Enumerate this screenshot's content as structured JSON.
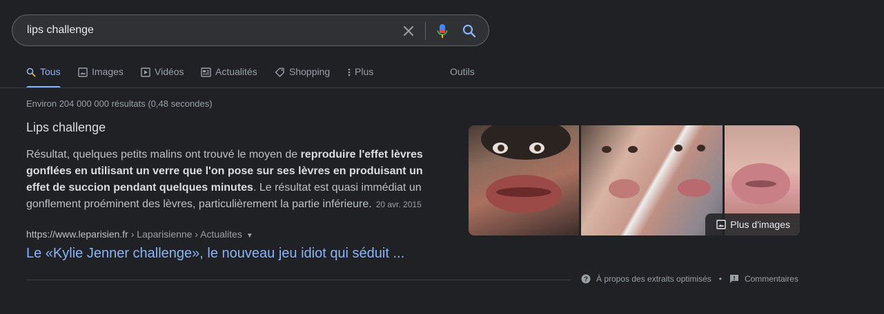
{
  "search": {
    "query": "lips challenge",
    "clear_icon": "close-icon",
    "mic_icon": "mic-icon",
    "search_icon": "search-icon"
  },
  "tabs": [
    {
      "label": "Tous",
      "icon": "search-icon",
      "active": true
    },
    {
      "label": "Images",
      "icon": "image-icon"
    },
    {
      "label": "Vidéos",
      "icon": "video-icon"
    },
    {
      "label": "Actualités",
      "icon": "news-icon"
    },
    {
      "label": "Shopping",
      "icon": "tag-icon"
    },
    {
      "label": "Plus",
      "icon": "more-vert-icon"
    },
    {
      "label": "Outils"
    }
  ],
  "stats": "Environ 204 000 000 résultats (0,48 secondes)",
  "snippet": {
    "title": "Lips challenge",
    "text_1": "Résultat, quelques petits malins ont trouvé le moyen de ",
    "text_bold": "reproduire l'effet lèvres gonflées en utilisant un verre que l'on pose sur ses lèvres en produisant un effet de succion pendant quelques minutes",
    "text_2": ". Le résultat est quasi immédiat un gonflement proéminent des lèvres, particulièrement la partie inférieure.",
    "date": "20 avr. 2015",
    "cite_domain": "https://www.leparisien.fr",
    "cite_path": " › Laparisienne › Actualites",
    "link_title": "Le «Kylie Jenner challenge», le nouveau jeu idiot qui séduit ..."
  },
  "images": {
    "more_label": "Plus d'images"
  },
  "footer": {
    "about_label": "À propos des extraits optimisés",
    "feedback_label": "Commentaires"
  },
  "colors": {
    "background": "#202124",
    "link": "#8ab4f8",
    "text": "#bdc1c6"
  }
}
